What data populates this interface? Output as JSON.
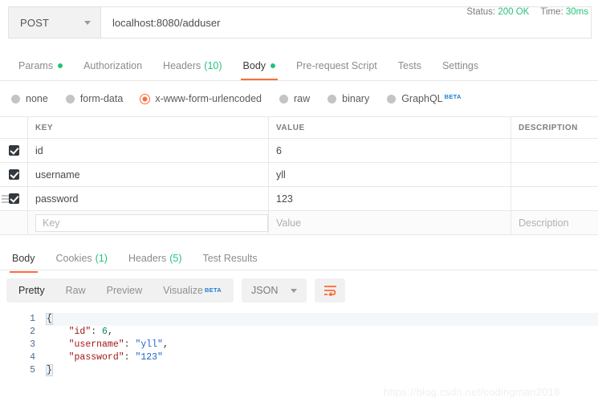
{
  "request": {
    "method": "POST",
    "url": "localhost:8080/adduser",
    "tabs": [
      {
        "label": "Params",
        "dot": true,
        "count": "",
        "active": false
      },
      {
        "label": "Authorization",
        "dot": false,
        "count": "",
        "active": false
      },
      {
        "label": "Headers",
        "dot": false,
        "count": "(10)",
        "active": false
      },
      {
        "label": "Body",
        "dot": true,
        "count": "",
        "active": true
      },
      {
        "label": "Pre-request Script",
        "dot": false,
        "count": "",
        "active": false
      },
      {
        "label": "Tests",
        "dot": false,
        "count": "",
        "active": false
      },
      {
        "label": "Settings",
        "dot": false,
        "count": "",
        "active": false
      }
    ],
    "body_types": [
      {
        "label": "none",
        "selected": false,
        "beta": ""
      },
      {
        "label": "form-data",
        "selected": false,
        "beta": ""
      },
      {
        "label": "x-www-form-urlencoded",
        "selected": true,
        "beta": ""
      },
      {
        "label": "raw",
        "selected": false,
        "beta": ""
      },
      {
        "label": "binary",
        "selected": false,
        "beta": ""
      },
      {
        "label": "GraphQL",
        "selected": false,
        "beta": "BETA"
      }
    ],
    "table": {
      "headers": {
        "key": "KEY",
        "value": "VALUE",
        "description": "DESCRIPTION"
      },
      "rows": [
        {
          "checked": true,
          "key": "id",
          "value": "6",
          "description": "",
          "handle": false
        },
        {
          "checked": true,
          "key": "username",
          "value": "yll",
          "description": "",
          "handle": false
        },
        {
          "checked": true,
          "key": "password",
          "value": "123",
          "description": "",
          "handle": true
        }
      ],
      "placeholders": {
        "key": "Key",
        "value": "Value",
        "description": "Description"
      }
    }
  },
  "response": {
    "tabs": [
      {
        "label": "Body",
        "count": "",
        "active": true
      },
      {
        "label": "Cookies",
        "count": "(1)",
        "active": false
      },
      {
        "label": "Headers",
        "count": "(5)",
        "active": false
      },
      {
        "label": "Test Results",
        "count": "",
        "active": false
      }
    ],
    "status_label": "Status:",
    "status_value": "200 OK",
    "time_label": "Time:",
    "time_value": "30ms",
    "view_modes": [
      {
        "label": "Pretty",
        "beta": "",
        "active": true
      },
      {
        "label": "Raw",
        "beta": "",
        "active": false
      },
      {
        "label": "Preview",
        "beta": "",
        "active": false
      },
      {
        "label": "Visualize",
        "beta": "BETA",
        "active": false
      }
    ],
    "format": "JSON",
    "wrap_icon": "word-wrap-icon",
    "json_lines": [
      {
        "n": "1",
        "parts": [
          {
            "t": "{",
            "c": "brace"
          }
        ]
      },
      {
        "n": "2",
        "parts": [
          {
            "t": "    ",
            "c": "p"
          },
          {
            "t": "\"id\"",
            "c": "k"
          },
          {
            "t": ": ",
            "c": "p"
          },
          {
            "t": "6",
            "c": "n"
          },
          {
            "t": ",",
            "c": "p"
          }
        ]
      },
      {
        "n": "3",
        "parts": [
          {
            "t": "    ",
            "c": "p"
          },
          {
            "t": "\"username\"",
            "c": "k"
          },
          {
            "t": ": ",
            "c": "p"
          },
          {
            "t": "\"yll\"",
            "c": "s"
          },
          {
            "t": ",",
            "c": "p"
          }
        ]
      },
      {
        "n": "4",
        "parts": [
          {
            "t": "    ",
            "c": "p"
          },
          {
            "t": "\"password\"",
            "c": "k"
          },
          {
            "t": ": ",
            "c": "p"
          },
          {
            "t": "\"123\"",
            "c": "s"
          }
        ]
      },
      {
        "n": "5",
        "parts": [
          {
            "t": "}",
            "c": "brace"
          }
        ]
      }
    ]
  },
  "watermark": "https://blog.csdn.net/codingman2018",
  "colors": {
    "accent": "#ff6c37",
    "success": "#28c07c",
    "beta": "#1e7fd4",
    "checkbox": "#32383c"
  }
}
